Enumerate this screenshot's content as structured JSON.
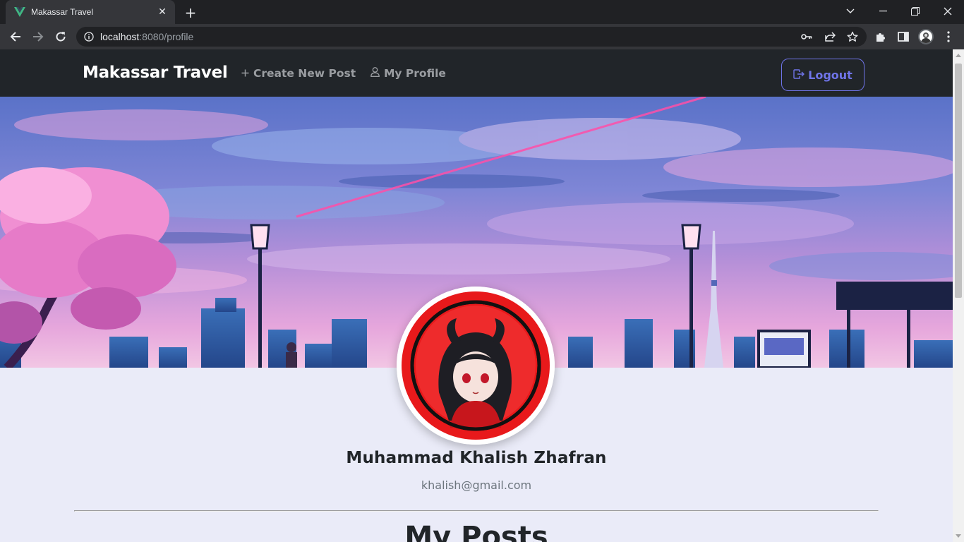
{
  "browser": {
    "tab_title": "Makassar Travel",
    "url_host": "localhost",
    "url_rest": ":8080/profile"
  },
  "navbar": {
    "brand": "Makassar Travel",
    "links": [
      {
        "label": "Create New Post",
        "icon": "plus-icon"
      },
      {
        "label": "My Profile",
        "icon": "person-icon"
      }
    ],
    "logout_label": "Logout",
    "logout_icon": "box-arrow-right-icon"
  },
  "profile": {
    "name": "Muhammad Khalish Zhafran",
    "email": "khalish@gmail.com"
  },
  "main": {
    "section_title": "My Posts"
  },
  "colors": {
    "navbar_bg": "#212529",
    "page_bg": "#eaebf8",
    "accent": "#6f74e8",
    "avatar_ring": "#e8191b"
  }
}
